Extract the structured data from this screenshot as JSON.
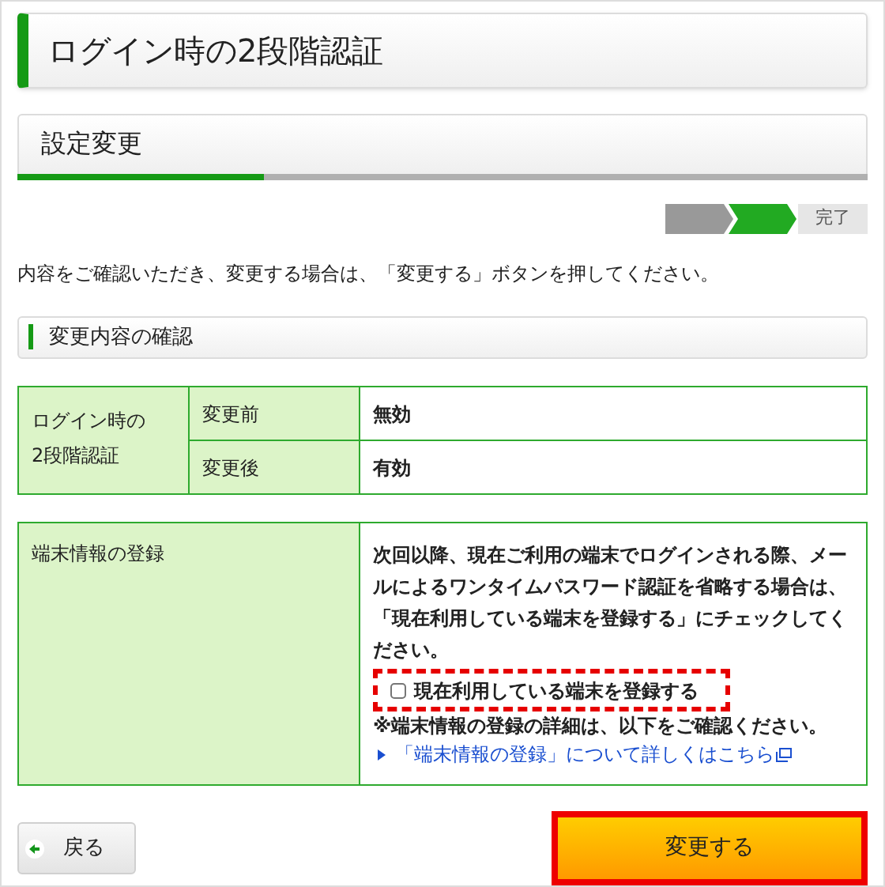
{
  "page_title": "ログイン時の2段階認証",
  "section": {
    "title": "設定変更",
    "progress": {
      "level": 0.29
    }
  },
  "steps": [
    {
      "completed": true,
      "selected": false
    },
    {
      "completed": false,
      "selected": true
    },
    {
      "completed": false,
      "selected": false,
      "label": "完了"
    }
  ],
  "instruction": "内容をご確認いただき、変更する場合は、「変更する」ボタンを押してください。",
  "confirm_heading": "変更内容の確認",
  "change_table": {
    "label": "ログイン時の2段階認証",
    "rows": [
      {
        "header": "変更前",
        "value": "無効"
      },
      {
        "header": "変更後",
        "value": "有効"
      }
    ]
  },
  "device_table": {
    "label": "端末情報の登録",
    "description": "次回以降、現在ご利用の端末でログインされる際、メールによるワンタイムパスワード認証を省略する場合は、「現在利用している端末を登録する」にチェックしてください。",
    "checkbox": {
      "label": "現在利用している端末を登録する",
      "checked": false,
      "highlighted": true
    },
    "note": "※端末情報の登録の詳細は、以下をご確認ください。",
    "link": "「端末情報の登録」について詳しくはこちら"
  },
  "buttons": {
    "back": "戻る",
    "submit": {
      "label": "変更する",
      "highlighted": true
    }
  }
}
